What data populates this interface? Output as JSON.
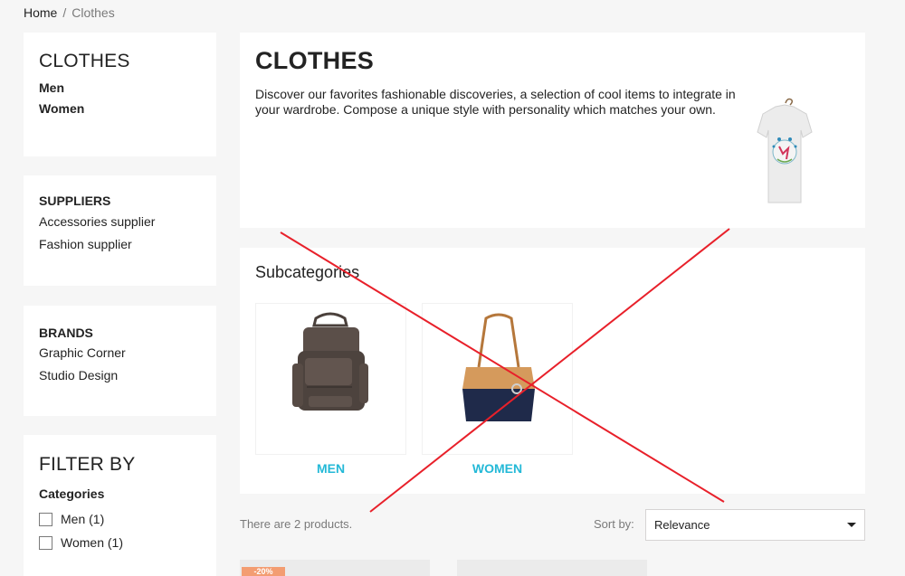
{
  "breadcrumb": {
    "home": "Home",
    "separator": "/",
    "current": "Clothes"
  },
  "sidebar": {
    "category": {
      "title": "CLOTHES",
      "items": [
        {
          "label": "Men"
        },
        {
          "label": "Women"
        }
      ]
    },
    "suppliers": {
      "title": "SUPPLIERS",
      "items": [
        {
          "label": "Accessories supplier"
        },
        {
          "label": "Fashion supplier"
        }
      ]
    },
    "brands": {
      "title": "BRANDS",
      "items": [
        {
          "label": "Graphic Corner"
        },
        {
          "label": "Studio Design"
        }
      ]
    },
    "filter": {
      "title": "FILTER BY",
      "facet_title": "Categories",
      "options": [
        {
          "label": "Men (1)",
          "checked": false
        },
        {
          "label": "Women (1)",
          "checked": false
        }
      ]
    }
  },
  "category_header": {
    "title": "CLOTHES",
    "description": "Discover our favorites fashionable discoveries, a selection of cool items to integrate in your wardrobe. Compose a unique style with personality which matches your own.",
    "image_icon": "tshirt-image"
  },
  "subcategories": {
    "title": "Subcategories",
    "items": [
      {
        "name": "MEN",
        "image_icon": "backpack-image"
      },
      {
        "name": "WOMEN",
        "image_icon": "tote-bag-image"
      }
    ]
  },
  "listing": {
    "count_text": "There are 2 products.",
    "sort_label": "Sort by:",
    "sort_value": "Relevance",
    "badge": "-20%"
  },
  "colors": {
    "accent_link": "#24b9d7",
    "overlay_cross": "#e8202a",
    "discount_badge": "#f39d72",
    "page_bg": "#f6f6f6"
  }
}
